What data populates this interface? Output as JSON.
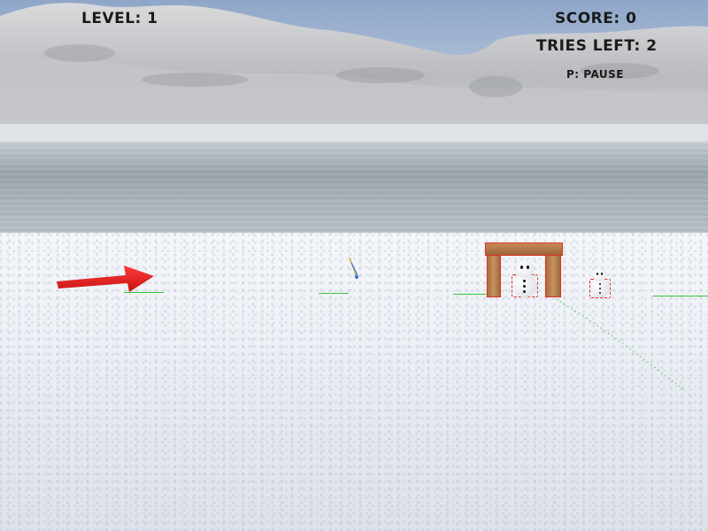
{
  "hud": {
    "level_label": "LEVEL: 1",
    "score_label": "SCORE: 0",
    "tries_label": "TRIES LEFT: 2",
    "pause_hint": "P: PAUSE"
  },
  "colors": {
    "aim_arrow": "#e82020",
    "target_outline": "#e0311f",
    "ground_marker": "#3bc63b",
    "hud_text": "#1a1a1a"
  },
  "icons": {
    "aim": "red-arrow-icon",
    "target": "snowman-icon",
    "goal": "wooden-gate-icon",
    "projectile": "dart-icon"
  }
}
